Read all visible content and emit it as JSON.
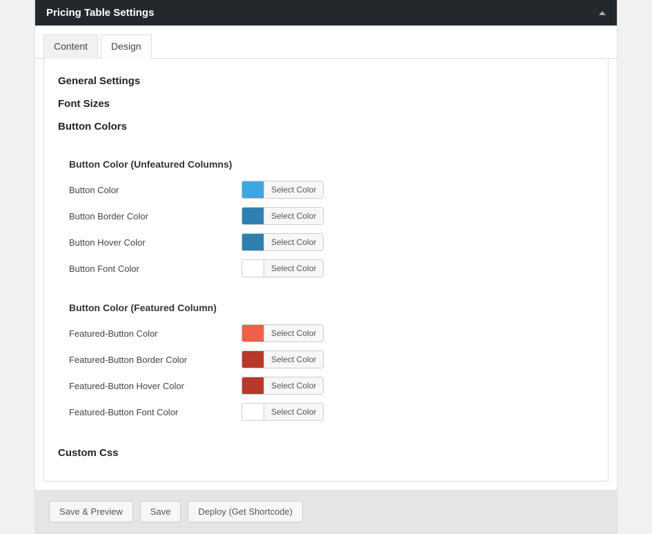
{
  "header": {
    "title": "Pricing Table Settings"
  },
  "tabs": {
    "content": "Content",
    "design": "Design"
  },
  "sections": {
    "general": "General Settings",
    "fontsizes": "Font Sizes",
    "buttoncolors": "Button Colors",
    "customcss": "Custom Css"
  },
  "unfeatured": {
    "heading": "Button Color (Unfeatured Columns)",
    "rows": [
      {
        "label": "Button Color",
        "swatch": "#3ea6e0"
      },
      {
        "label": "Button Border Color",
        "swatch": "#2e80b2"
      },
      {
        "label": "Button Hover Color",
        "swatch": "#2e80b2"
      },
      {
        "label": "Button Font Color",
        "swatch": "#ffffff"
      }
    ]
  },
  "featured": {
    "heading": "Button Color (Featured Column)",
    "rows": [
      {
        "label": "Featured-Button Color",
        "swatch": "#ee6048"
      },
      {
        "label": "Featured-Button Border Color",
        "swatch": "#b8382a"
      },
      {
        "label": "Featured-Button Hover Color",
        "swatch": "#b8382a"
      },
      {
        "label": "Featured-Button Font Color",
        "swatch": "#ffffff"
      }
    ]
  },
  "selectColorLabel": "Select Color",
  "buttons": {
    "savepreview": "Save & Preview",
    "save": "Save",
    "deploy": "Deploy (Get Shortcode)"
  }
}
